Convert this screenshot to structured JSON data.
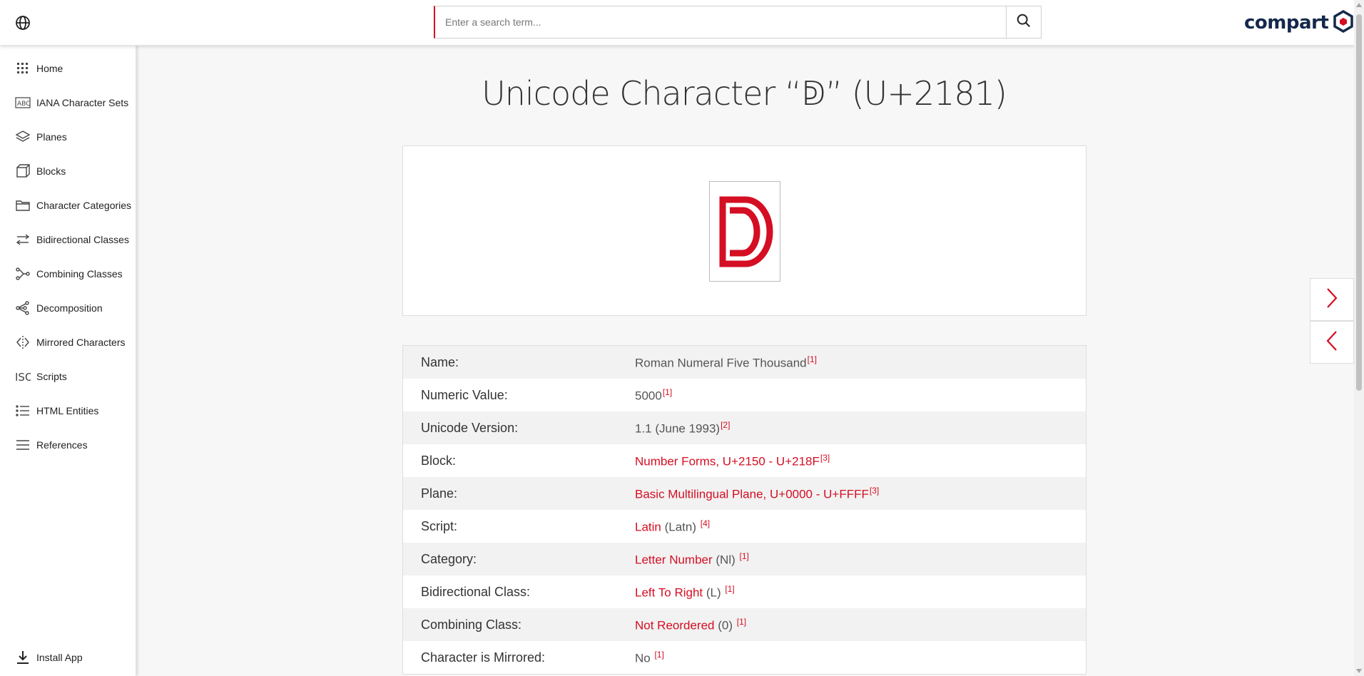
{
  "header": {
    "search_placeholder": "Enter a search term...",
    "logo_text": "compart",
    "accent_color": "#d40e23",
    "icons": [
      "globe-icon",
      "search-icon",
      "compart-logo"
    ]
  },
  "sidebar": {
    "items": [
      {
        "label": "Home",
        "icon": "grid-icon"
      },
      {
        "label": "IANA Character Sets",
        "icon": "abc-icon"
      },
      {
        "label": "Planes",
        "icon": "layers-icon"
      },
      {
        "label": "Blocks",
        "icon": "cube-icon"
      },
      {
        "label": "Character Categories",
        "icon": "folder-icon"
      },
      {
        "label": "Bidirectional Classes",
        "icon": "arrows-icon"
      },
      {
        "label": "Combining Classes",
        "icon": "combine-icon"
      },
      {
        "label": "Decomposition",
        "icon": "share-icon"
      },
      {
        "label": "Mirrored Characters",
        "icon": "mirror-icon"
      },
      {
        "label": "Scripts",
        "icon": "iso-icon"
      },
      {
        "label": "HTML Entities",
        "icon": "list-icon"
      },
      {
        "label": "References",
        "icon": "menu-icon"
      }
    ],
    "install_label": "Install App"
  },
  "page": {
    "title": "Unicode Character “ↁ” (U+2181)",
    "glyph": "ↁ"
  },
  "properties": [
    {
      "key": "Name:",
      "parts": [
        {
          "t": "Roman Numeral Five Thousand"
        }
      ],
      "ref": "[1]"
    },
    {
      "key": "Numeric Value:",
      "parts": [
        {
          "t": "5000"
        }
      ],
      "ref": "[1]"
    },
    {
      "key": "Unicode Version:",
      "parts": [
        {
          "t": "1.1 (June 1993)"
        }
      ],
      "ref": "[2]"
    },
    {
      "key": "Block:",
      "parts": [
        {
          "t": "Number Forms, U+2150 - U+218F",
          "link": true
        }
      ],
      "ref": "[3]"
    },
    {
      "key": "Plane:",
      "parts": [
        {
          "t": "Basic Multilingual Plane, U+0000 - U+FFFF",
          "link": true
        }
      ],
      "ref": "[3]"
    },
    {
      "key": "Script:",
      "parts": [
        {
          "t": "Latin",
          "link": true
        },
        {
          "t": " (Latn) "
        }
      ],
      "ref": "[4]"
    },
    {
      "key": "Category:",
      "parts": [
        {
          "t": "Letter Number",
          "link": true
        },
        {
          "t": " (Nl) "
        }
      ],
      "ref": "[1]"
    },
    {
      "key": "Bidirectional Class:",
      "parts": [
        {
          "t": "Left To Right",
          "link": true
        },
        {
          "t": " (L) "
        }
      ],
      "ref": "[1]"
    },
    {
      "key": "Combining Class:",
      "parts": [
        {
          "t": "Not Reordered",
          "link": true
        },
        {
          "t": " (0) "
        }
      ],
      "ref": "[1]"
    },
    {
      "key": "Character is Mirrored:",
      "parts": [
        {
          "t": "No "
        }
      ],
      "ref": "[1]"
    }
  ]
}
